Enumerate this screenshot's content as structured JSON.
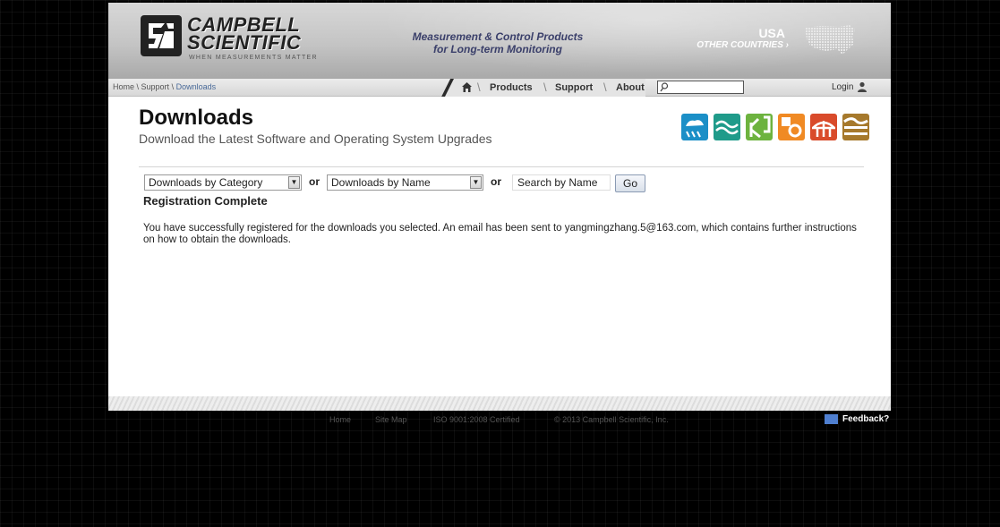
{
  "header": {
    "logo_line1": "CAMPBELL",
    "logo_line2": "SCIENTIFIC",
    "logo_tagline": "WHEN MEASUREMENTS MATTER",
    "tagline_line1": "Measurement & Control Products",
    "tagline_line2": "for Long-term Monitoring",
    "region_current": "USA",
    "region_other": "OTHER COUNTRIES ›"
  },
  "nav": {
    "breadcrumb": [
      "Home",
      "Support",
      "Downloads"
    ],
    "links": [
      "Products",
      "Support",
      "About"
    ],
    "search_placeholder": "",
    "login": "Login"
  },
  "main": {
    "title": "Downloads",
    "subtitle": "Download the Latest Software and Operating System Upgrades",
    "market_icons": [
      {
        "name": "weather-icon",
        "color": "#1b8fc7"
      },
      {
        "name": "water-icon",
        "color": "#1f9b8a"
      },
      {
        "name": "agriculture-icon",
        "color": "#6db33f"
      },
      {
        "name": "energy-icon",
        "color": "#f08a24"
      },
      {
        "name": "infrastructure-icon",
        "color": "#d94b2b"
      },
      {
        "name": "soil-icon",
        "color": "#a6792c"
      }
    ],
    "category_select": "Downloads by Category",
    "or_label": "or",
    "name_select": "Downloads by Name",
    "search_value": "Search by Name",
    "go_label": "Go",
    "registration_title": "Registration Complete",
    "registration_message": "You have successfully registered for the downloads you selected. An email has been sent to yangmingzhang.5@163.com, which contains further instructions on how to obtain the downloads."
  },
  "footer": {
    "links": [
      "Home",
      "Site Map",
      "ISO 9001:2008 Certified",
      "© 2013 Campbell Scientific, Inc."
    ],
    "feedback": "Feedback?"
  }
}
